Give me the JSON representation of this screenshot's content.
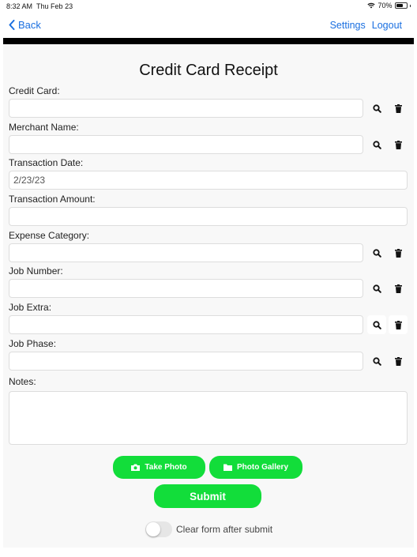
{
  "status_bar": {
    "time": "8:32 AM",
    "date": "Thu Feb 23",
    "battery": "70%",
    "battery_level": 0.7
  },
  "nav": {
    "back_label": "Back",
    "settings_label": "Settings",
    "logout_label": "Logout"
  },
  "form": {
    "title": "Credit Card Receipt",
    "fields": {
      "credit_card": {
        "label": "Credit Card:",
        "value": ""
      },
      "merchant_name": {
        "label": "Merchant Name:",
        "value": ""
      },
      "transaction_date": {
        "label": "Transaction Date:",
        "value": "2/23/23"
      },
      "transaction_amount": {
        "label": "Transaction Amount:",
        "value": ""
      },
      "expense_category": {
        "label": "Expense Category:",
        "value": ""
      },
      "job_number": {
        "label": "Job Number:",
        "value": ""
      },
      "job_extra": {
        "label": "Job Extra:",
        "value": ""
      },
      "job_phase": {
        "label": "Job Phase:",
        "value": ""
      },
      "notes": {
        "label": "Notes:",
        "value": ""
      }
    }
  },
  "actions": {
    "take_photo_label": "Take Photo",
    "photo_gallery_label": "Photo Gallery",
    "submit_label": "Submit"
  },
  "clear_toggle": {
    "label": "Clear form after submit",
    "on": false
  },
  "colors": {
    "accent_blue": "#1a6fe0",
    "button_green": "#12dd3a"
  },
  "icons": {
    "back": "chevron-left-icon",
    "search": "search-icon",
    "delete": "trash-icon",
    "camera": "camera-icon",
    "folder": "folder-icon",
    "wifi": "wifi-icon",
    "battery": "battery-icon"
  }
}
